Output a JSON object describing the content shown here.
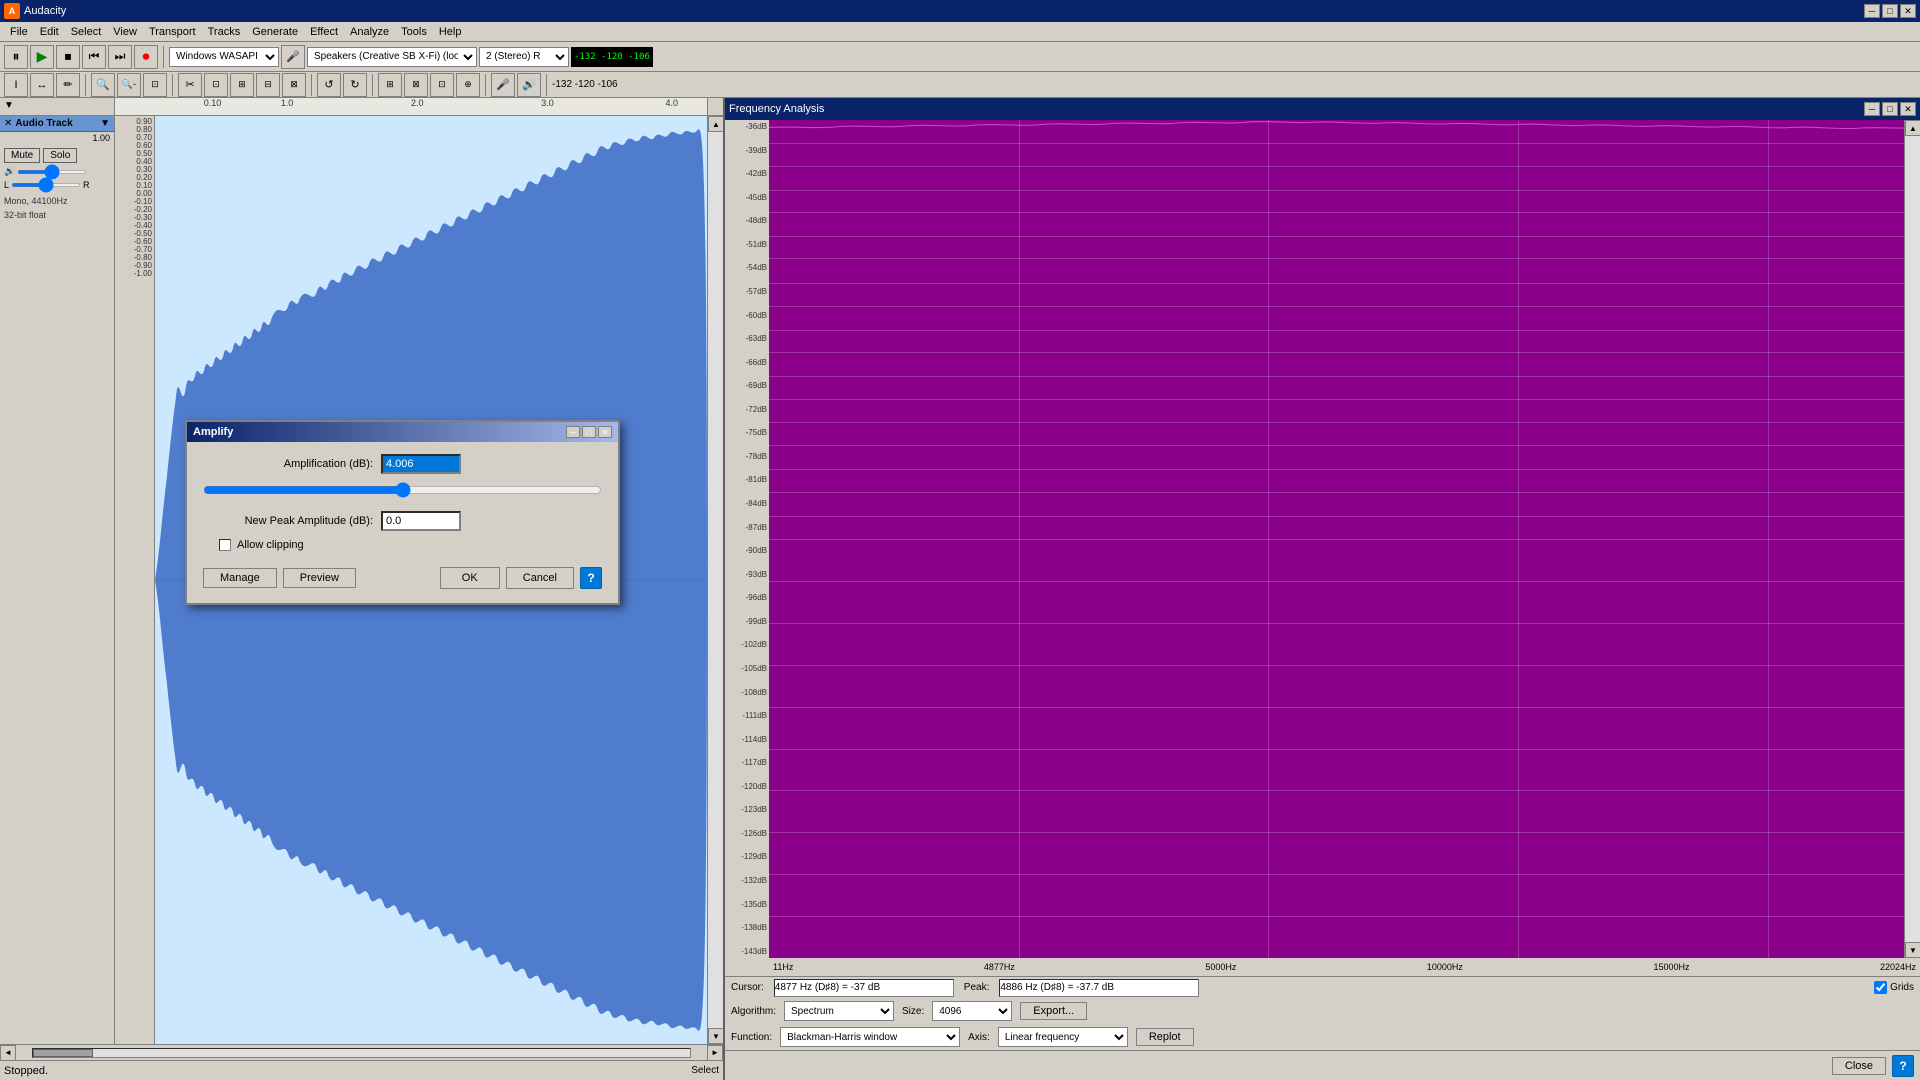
{
  "app": {
    "title": "Audacity",
    "icon": "A"
  },
  "title_bar": {
    "text": "Audacity",
    "min_btn": "─",
    "max_btn": "□",
    "close_btn": "✕"
  },
  "menu": {
    "items": [
      "File",
      "Edit",
      "Select",
      "View",
      "Transport",
      "Tracks",
      "Generate",
      "Effect",
      "Analyze",
      "Tools",
      "Help"
    ]
  },
  "toolbar": {
    "transport": {
      "pause": "⏸",
      "play": "▶",
      "stop": "⏹",
      "prev": "⏮",
      "next": "⏭",
      "record": "⏺"
    },
    "wasapi_label": "Windows WASAP|▼",
    "mic_label": "Speakers (Creative SB X-Fi) (loo▼",
    "stereo_label": "2 (Stereo) R▼",
    "level": "-132 -120 -10€"
  },
  "toolbar2": {
    "zoom_in": "+",
    "zoom_out": "─",
    "fit": "⊡",
    "tools": [
      "↖",
      "↔",
      "✏",
      "⊠",
      "⊞",
      "↕",
      "◉",
      "⊕",
      "⊖",
      "⊙"
    ],
    "cut": "✂",
    "copy": "⊡",
    "paste": "⊠",
    "trim": "⊟",
    "silence": "⊠",
    "undo": "↺",
    "redo": "↻",
    "zoom_sel": "⊞",
    "zoom_fit": "⊠",
    "zoom_full": "⊡",
    "zoom_toggle": "⊕",
    "mic_icon": "🎤",
    "spk_icon": "🔊"
  },
  "track": {
    "name": "Audio Track",
    "volume_label": "1.00",
    "gain_label": "Volume",
    "pan_label": "Pan",
    "pan_l": "L",
    "pan_r": "R",
    "mute_label": "Mute",
    "solo_label": "Solo",
    "info_line1": "Mono, 44100Hz",
    "info_line2": "32-bit float"
  },
  "ruler": {
    "ticks": [
      "0.10",
      "1.0",
      "2.0",
      "3.0",
      "4.0"
    ]
  },
  "db_scale": {
    "labels": [
      "0.90",
      "0.80",
      "0.70",
      "0.60",
      "0.50",
      "0.40",
      "0.30",
      "0.20",
      "0.10",
      "0.00",
      "-0.10",
      "-0.20",
      "-0.30",
      "-0.40",
      "-0.50",
      "-0.60",
      "-0.70",
      "-0.80",
      "-0.90",
      "-1.00"
    ]
  },
  "amplify_dialog": {
    "title": "Amplify",
    "amp_label": "Amplification (dB):",
    "amp_value": "4.006",
    "peak_label": "New Peak Amplitude (dB):",
    "peak_value": "0.0",
    "allow_clipping_label": "Allow clipping",
    "allow_clipping_checked": false,
    "manage_btn": "Manage",
    "preview_btn": "Preview",
    "ok_btn": "OK",
    "cancel_btn": "Cancel",
    "help_btn": "?",
    "min_btn": "─",
    "max_btn": "□",
    "close_btn": "✕"
  },
  "freq_analysis": {
    "title": "Frequency Analysis",
    "db_labels": [
      "-36dB",
      "-39dB",
      "-42dB",
      "-45dB",
      "-48dB",
      "-51dB",
      "-54dB",
      "-57dB",
      "-60dB",
      "-63dB",
      "-66dB",
      "-69dB",
      "-72dB",
      "-75dB",
      "-78dB",
      "-81dB",
      "-84dB",
      "-87dB",
      "-90dB",
      "-93dB",
      "-96dB",
      "-99dB",
      "-102dB",
      "-105dB",
      "-108dB",
      "-111dB",
      "-114dB",
      "-117dB",
      "-120dB",
      "-123dB",
      "-126dB",
      "-129dB",
      "-132dB",
      "-135dB",
      "-138dB",
      "-143dB"
    ],
    "hz_labels": [
      "11Hz",
      "4877Hz",
      "5000Hz",
      "10000Hz",
      "15000Hz",
      "22024Hz"
    ],
    "cursor_label": "Cursor:",
    "cursor_value": "4877 Hz (D♯8) = -37 dB",
    "peak_label": "Peak:",
    "peak_value": "4886 Hz (D♯8) = -37.7 dB",
    "grids_label": "Grids",
    "algorithm_label": "Algorithm:",
    "algorithm_value": "Spectrum",
    "size_label": "Size:",
    "size_value": "4096",
    "export_btn": "Export...",
    "function_label": "Function:",
    "function_value": "Blackman-Harris window",
    "axis_label": "Axis:",
    "axis_value": "Linear frequency",
    "replot_btn": "Replot",
    "close_btn": "Close",
    "help_btn": "?"
  },
  "status": {
    "text": "Stopped.",
    "tool": "Select"
  }
}
